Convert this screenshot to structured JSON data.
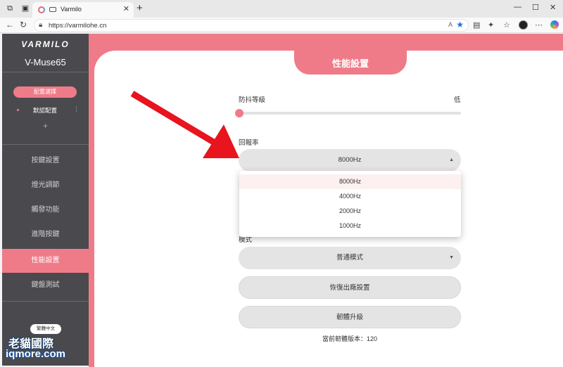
{
  "browser": {
    "tab_title": "Varmilo",
    "url": "https://varmilohe.cn",
    "read_aloud": "A",
    "new_tab": "+",
    "tab_close": "✕"
  },
  "sidebar": {
    "logo": "VARMILO",
    "model": "V-Muse65",
    "config_button": "配置選擇",
    "config_item": "默認配置",
    "config_more": "⋮",
    "config_add": "+",
    "items": [
      {
        "label": "按鍵設置"
      },
      {
        "label": "燈光調節"
      },
      {
        "label": "觸發功能"
      },
      {
        "label": "進階按鍵"
      },
      {
        "label": "性能設置"
      },
      {
        "label": "鍵盤測試"
      }
    ],
    "language": "繁體中文"
  },
  "main": {
    "title": "性能設置",
    "debounce_label": "防抖等級",
    "debounce_value": "低",
    "debounce_level": 0,
    "polling_label": "回報率",
    "polling_selected": "8000Hz",
    "polling_options": [
      "8000Hz",
      "4000Hz",
      "2000Hz",
      "1000Hz"
    ],
    "mode_label": "模式",
    "mode_selected": "普通模式",
    "reset_button": "恢復出廠設置",
    "firmware_button": "韌體升級",
    "firmware_version": "當前韌體版本：120"
  },
  "watermark": {
    "line1": "老貓國際",
    "line2": "iqmore.com"
  },
  "colors": {
    "accent": "#f07b88",
    "sidebar": "#4a4a4e",
    "annotation_arrow": "#e8141e"
  }
}
